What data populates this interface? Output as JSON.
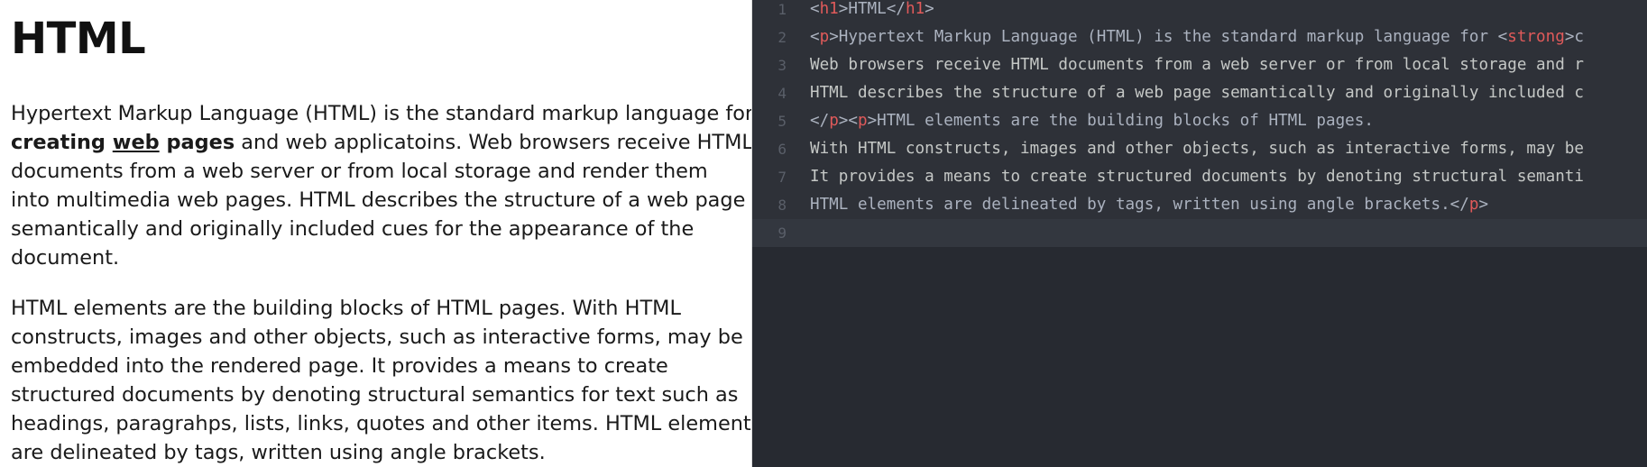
{
  "preview": {
    "heading": "HTML",
    "p1": {
      "l1": "Hypertext Markup Language (HTML) is the standard markup language for",
      "l2_strong_a": "creating ",
      "l2_strong_u": "web",
      "l2_strong_b": " pages",
      "l2_rest": " and web applicatoins. Web browsers receive HTML",
      "l3": "documents from a web server or from local storage and render them",
      "l4": "into multimedia web pages. HTML describes the structure of a web page",
      "l5": "semantically and originally included cues for the appearance of the",
      "l6": "document."
    },
    "p2": {
      "l1": "HTML elements are the building blocks of HTML pages. With HTML",
      "l2": "constructs, images and other objects, such as interactive forms, may be",
      "l3": "embedded into the rendered page. It provides a means to create",
      "l4": "structured documents by denoting structural semantics for text such as",
      "l5": "headings, paragrahps, lists, links, quotes and other items. HTML elements",
      "l6": "are delineated by tags, written using angle brackets."
    }
  },
  "editor": {
    "colors": {
      "background": "#272a31",
      "tag": "#e05a5a",
      "text": "#c5c8c6",
      "gutter": "#5a5f69"
    },
    "lines": [
      {
        "num": "1",
        "t1": "<",
        "tag1": "h1",
        "t2": ">HTML</",
        "tag2": "h1",
        "t3": ">"
      },
      {
        "num": "2",
        "t1": "<",
        "tag1": "p",
        "t2": ">Hypertext Markup Language (HTML) is the standard markup language for <",
        "tag2": "strong",
        "t3": ">c"
      },
      {
        "num": "3",
        "text": "Web browsers receive HTML documents from a web server or from local storage and r"
      },
      {
        "num": "4",
        "text": "HTML describes the structure of a web page semantically and originally included c"
      },
      {
        "num": "5",
        "t1": "</",
        "tag1": "p",
        "t2": "><",
        "tag2": "p",
        "t3": ">HTML elements are the building blocks of HTML pages."
      },
      {
        "num": "6",
        "text": "With HTML constructs, images and other objects, such as interactive forms, may be"
      },
      {
        "num": "7",
        "text": "It provides a means to create structured documents by denoting structural semanti"
      },
      {
        "num": "8",
        "t1": "HTML elements are delineated by tags, written using angle brackets.</",
        "tag1": "p",
        "t2": ">"
      },
      {
        "num": "9",
        "text": ""
      }
    ]
  }
}
